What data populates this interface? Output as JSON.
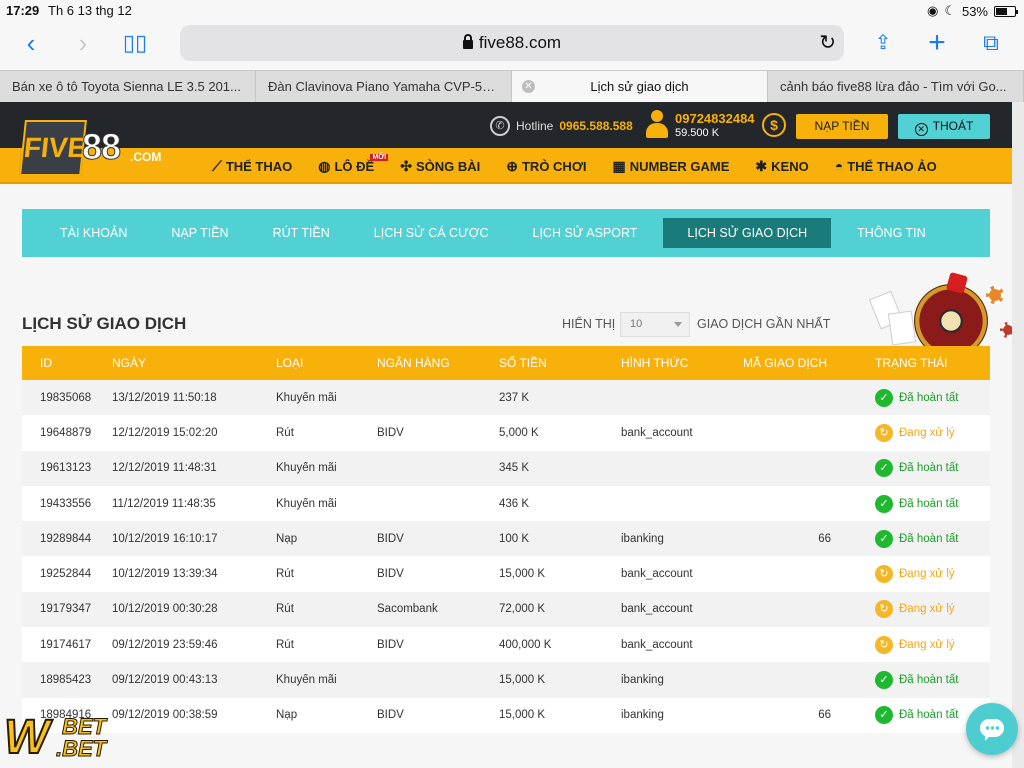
{
  "status": {
    "time": "17:29",
    "date": "Th 6 13 thg 12",
    "battery": "53%"
  },
  "browser": {
    "url": "five88.com",
    "tabs": [
      {
        "label": "Bán xe ô tô Toyota Sienna LE 3.5 201..."
      },
      {
        "label": "Đàn Clavinova Piano Yamaha CVP-50..."
      },
      {
        "label": "Lịch sử giao dịch"
      },
      {
        "label": "cảnh báo five88 lừa đảo - Tìm với Go..."
      }
    ]
  },
  "site": {
    "logo_five": "FIVE",
    "logo_88": "88",
    "logo_com": ".COM",
    "hotline_label": "Hotline",
    "hotline_number": "0965.588.588",
    "phone": "09724832484",
    "balance": "59.500 K",
    "deposit_button": "NẠP TIỀN",
    "logout_button": "THOÁT",
    "nav": [
      {
        "label": "THỂ THAO",
        "icon": "whistle-icon",
        "glyph": "⟋"
      },
      {
        "label": "LÔ ĐỀ",
        "icon": "globe-icon",
        "glyph": "◍",
        "badge": "MỚI"
      },
      {
        "label": "SÒNG BÀI",
        "icon": "chips-icon",
        "glyph": "✣"
      },
      {
        "label": "TRÒ CHƠI",
        "icon": "gamepad-icon",
        "glyph": "⊕"
      },
      {
        "label": "NUMBER GAME",
        "icon": "grid-icon",
        "glyph": "▦"
      },
      {
        "label": "KENO",
        "icon": "keno-icon",
        "glyph": "✱"
      },
      {
        "label": "THỂ THAO ẢO",
        "icon": "helmet-icon",
        "glyph": "◓"
      }
    ]
  },
  "account_tabs": [
    {
      "label": "TÀI KHOẢN"
    },
    {
      "label": "NẠP TIỀN"
    },
    {
      "label": "RÚT TIỀN"
    },
    {
      "label": "LỊCH SỬ CÁ CƯỢC"
    },
    {
      "label": "LỊCH SỬ ASPORT"
    },
    {
      "label": "LỊCH SỬ GIAO DỊCH",
      "active": true
    },
    {
      "label": "THÔNG TIN"
    }
  ],
  "section": {
    "title": "LỊCH SỬ GIAO DỊCH",
    "show_label": "HIỂN THỊ",
    "show_value": "10",
    "show_suffix": "GIAO DỊCH GẦN NHẤT"
  },
  "table": {
    "headers": [
      "ID",
      "NGÀY",
      "LOẠI",
      "NGÂN HÀNG",
      "SỐ TIỀN",
      "HÌNH THỨC",
      "MÃ GIAO DỊCH",
      "TRẠNG THÁI"
    ],
    "rows": [
      {
        "id": "19835068",
        "date": "13/12/2019 11:50:18",
        "type": "Khuyến mãi",
        "bank": "",
        "amount": "237 K",
        "method": "",
        "code": "",
        "status": "Đã hoàn tất",
        "ok": true
      },
      {
        "id": "19648879",
        "date": "12/12/2019 15:02:20",
        "type": "Rút",
        "bank": "BIDV",
        "amount": "5,000 K",
        "method": "bank_account",
        "code": "",
        "status": "Đang xử lý",
        "ok": false
      },
      {
        "id": "19613123",
        "date": "12/12/2019 11:48:31",
        "type": "Khuyến mãi",
        "bank": "",
        "amount": "345 K",
        "method": "",
        "code": "",
        "status": "Đã hoàn tất",
        "ok": true
      },
      {
        "id": "19433556",
        "date": "11/12/2019 11:48:35",
        "type": "Khuyến mãi",
        "bank": "",
        "amount": "436 K",
        "method": "",
        "code": "",
        "status": "Đã hoàn tất",
        "ok": true
      },
      {
        "id": "19289844",
        "date": "10/12/2019 16:10:17",
        "type": "Nạp",
        "bank": "BIDV",
        "amount": "100 K",
        "method": "ibanking",
        "code": "66",
        "status": "Đã hoàn tất",
        "ok": true
      },
      {
        "id": "19252844",
        "date": "10/12/2019 13:39:34",
        "type": "Rút",
        "bank": "BIDV",
        "amount": "15,000 K",
        "method": "bank_account",
        "code": "",
        "status": "Đang xử lý",
        "ok": false
      },
      {
        "id": "19179347",
        "date": "10/12/2019 00:30:28",
        "type": "Rút",
        "bank": "Sacombank",
        "amount": "72,000 K",
        "method": "bank_account",
        "code": "",
        "status": "Đang xử lý",
        "ok": false
      },
      {
        "id": "19174617",
        "date": "09/12/2019 23:59:46",
        "type": "Rút",
        "bank": "BIDV",
        "amount": "400,000 K",
        "method": "bank_account",
        "code": "",
        "status": "Đang xử lý",
        "ok": false
      },
      {
        "id": "18985423",
        "date": "09/12/2019 00:43:13",
        "type": "Khuyến mãi",
        "bank": "",
        "amount": "15,000 K",
        "method": "ibanking",
        "code": "",
        "status": "Đã hoàn tất",
        "ok": true
      },
      {
        "id": "18984916",
        "date": "09/12/2019 00:38:59",
        "type": "Nạp",
        "bank": "BIDV",
        "amount": "15,000 K",
        "method": "ibanking",
        "code": "66",
        "status": "Đã hoàn tất",
        "ok": true
      }
    ]
  },
  "watermark": {
    "w": "W",
    "bet1": "BET",
    "bet2": ".BET"
  }
}
